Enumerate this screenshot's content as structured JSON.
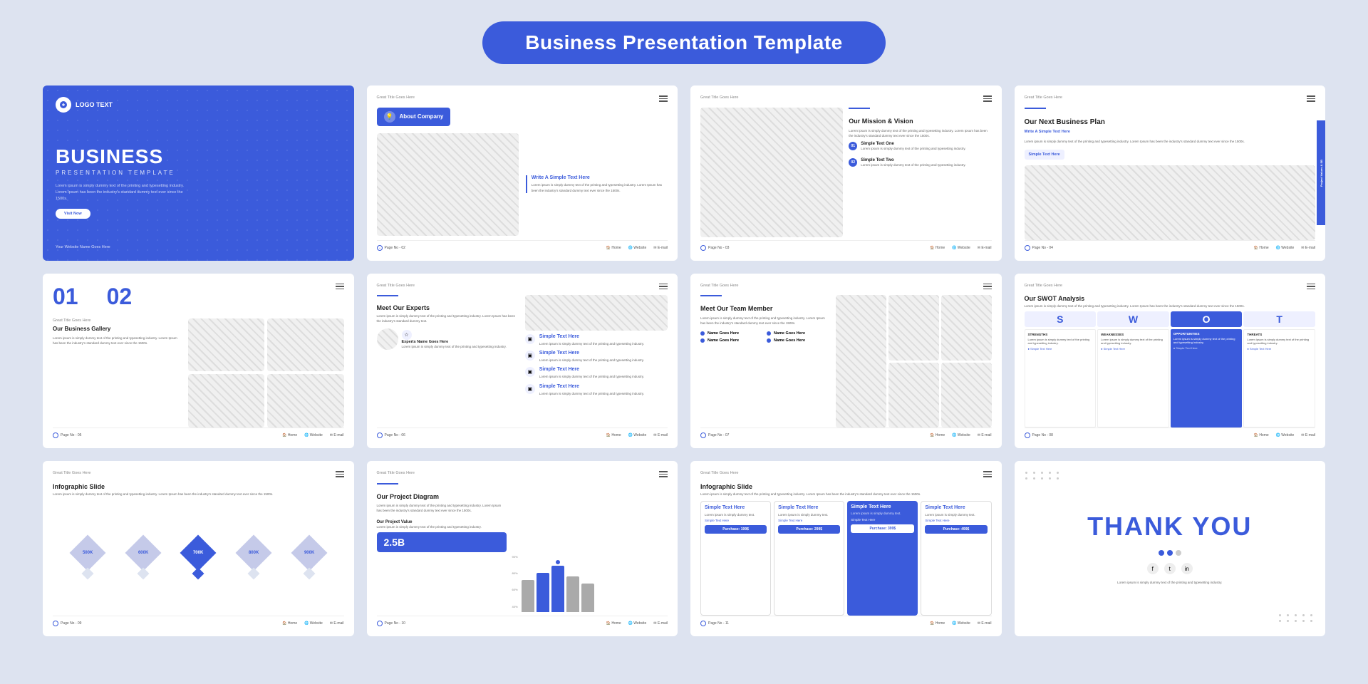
{
  "page": {
    "title": "Business Presentation Template",
    "background": "#dde3f0"
  },
  "slides": [
    {
      "id": 1,
      "type": "cover",
      "logo": "LOGO TEXT",
      "title": "BUSINESS",
      "subtitle": "PRESENTATION TEMPLATE",
      "description": "Lorem ipsum is simply dummy text of the printing and typesetting industry. Lorem Ipsum has been the industry's standard dummy text ever since the 1500s.",
      "button": "Visit Now",
      "website": "Your Website Name Goes Here"
    },
    {
      "id": 2,
      "type": "about",
      "great_title": "Great Title Goes Here",
      "badge": "About Company",
      "write_title": "Write A Simple Text Here",
      "description": "Lorem ipsum is simply dummy text of the printing and typesetting industry. Lorem Ipsum has been the industry's standard dummy text ever since the 1500s.",
      "page": "Page No - 02",
      "footer": [
        "Home",
        "Website",
        "E-mail"
      ]
    },
    {
      "id": 3,
      "type": "mission",
      "great_title": "Great Title Goes Here",
      "title": "Our Mission & Vision",
      "description": "Lorem ipsum is simply dummy text of the printing and typesetting industry. Lorem Ipsum has been the industry's standard dummy text ever since the 1500s.",
      "items": [
        {
          "num": "01",
          "title": "Simple Text One",
          "text": "Lorem ipsum is simply dummy text of the printing and typesetting industry."
        },
        {
          "num": "02",
          "title": "Simple Text Two",
          "text": "Lorem ipsum is simply dummy text of the printing and typesetting industry."
        }
      ],
      "page": "Page No - 03",
      "footer": [
        "Home",
        "Website",
        "E-mail"
      ]
    },
    {
      "id": 4,
      "type": "bizplan",
      "great_title": "Great Title Goes Here",
      "title": "Our Next Business Plan",
      "write_title": "Write A Simple Text Here",
      "description": "Lorem ipsum is simply dummy text of the printing and typesetting industry. Lorem Ipsum has been the industry's standard dummy text ever since the 1500s.",
      "simple_text": "Simple Text Here",
      "tab_label": "Project Values & SB",
      "page": "Page No - 04",
      "footer": [
        "Home",
        "Website",
        "E-mail"
      ]
    },
    {
      "id": 5,
      "type": "gallery",
      "great_title": "Great Title Goes Here",
      "title": "Our Business Gallery",
      "nums": [
        "01",
        "02"
      ],
      "description": "Lorem ipsum is simply dummy text of the printing and typesetting industry. Lorem Ipsum has been the industry's standard dummy text ever since the 1500s.",
      "page": "Page No - 05",
      "footer": [
        "Home",
        "Website",
        "E-mail"
      ]
    },
    {
      "id": 6,
      "type": "experts",
      "great_title": "Great Title Goes Here",
      "title": "Meet Our Experts",
      "description": "Lorem ipsum is simply dummy text of the printing and typesetting industry. Lorem Ipsum has been the industry's standard dummy text.",
      "items": [
        {
          "label": "Simple Text Here",
          "text": "Lorem ipsum is simply dummy text of the printing and typesetting industry."
        },
        {
          "label": "Simple Text Here",
          "text": "Lorem ipsum is simply dummy text of the printing and typesetting industry."
        },
        {
          "label": "Simple Text Here",
          "text": "Lorem ipsum is simply dummy text of the printing and typesetting industry."
        },
        {
          "label": "Simple Text Here",
          "text": "Lorem ipsum is simply dummy text of the printing and typesetting industry."
        }
      ],
      "expert_icon": "☆",
      "expert_name": "Experts Name Goes Here",
      "expert_desc": "Lorem ipsum is simply dummy text of the printing and typesetting industry.",
      "page": "Page No - 06",
      "footer": [
        "Home",
        "Website",
        "E-mail"
      ]
    },
    {
      "id": 7,
      "type": "team",
      "great_title": "Great Title Goes Here",
      "title": "Meet Our Team Member",
      "description": "Lorem ipsum is simply dummy text of the printing and typesetting industry. Lorem Ipsum has been the industry's standard dummy text ever since the 1500s.",
      "members": [
        {
          "name": "Name Goes Here",
          "name2": "Name Goes Here"
        },
        {
          "name": "Name Goes Here",
          "name2": "Name Goes Here"
        }
      ],
      "page": "Page No - 07",
      "footer": [
        "Home",
        "Website",
        "E-mail"
      ]
    },
    {
      "id": 8,
      "type": "swot",
      "great_title": "Great Title Goes Here",
      "title": "Our SWOT Analysis",
      "description": "Lorem ipsum is simply dummy text of the printing and typesetting industry. Lorem Ipsum has been the industry's standard dummy text ever since the 1500s.",
      "letters": [
        "S",
        "W",
        "O",
        "T"
      ],
      "sections": [
        {
          "label": "STRENGTHS",
          "text": "Lorem ipsum is simply dummy text of the printing and typesetting industry."
        },
        {
          "label": "WEAKNESSES",
          "text": "Lorem ipsum is simply dummy text of the printing and typesetting industry."
        },
        {
          "label": "OPPORTUNITIES",
          "text": "Lorem ipsum is simply dummy text of the printing and typesetting industry."
        },
        {
          "label": "THREATS",
          "text": "Lorem ipsum is simply dummy text of the printing and typesetting industry."
        }
      ],
      "page": "Page No - 08",
      "footer": [
        "Home",
        "Website",
        "E-mail"
      ]
    },
    {
      "id": 9,
      "type": "infographic1",
      "great_title": "Great Title Goes Here",
      "title": "Infographic Slide",
      "description": "Lorem ipsum is simply dummy text of the printing and typesetting industry. Lorem Ipsum has been the industry's standard dummy text ever since the 1500s.",
      "values": [
        "500K",
        "600K",
        "700K",
        "800K",
        "900K"
      ],
      "page": "Page No - 09",
      "footer": [
        "Home",
        "Website",
        "E-mail"
      ]
    },
    {
      "id": 10,
      "type": "project",
      "great_title": "Great Title Goes Here",
      "title": "Our Project Diagram",
      "description": "Lorem ipsum is simply dummy text of the printing and typesetting industry. Lorem Ipsum has been the industry's standard dummy text ever since the 1500s.",
      "project_value_label": "Our Project Value",
      "project_value_desc": "Lorem ipsum is simply dummy text of the printing and typesetting industry.",
      "value": "2.5B",
      "y_axis": [
        "90%",
        "80%",
        "60%",
        "40%"
      ],
      "page": "Page No - 10",
      "footer": [
        "Home",
        "Website",
        "E-mail"
      ]
    },
    {
      "id": 11,
      "type": "infographic2",
      "great_title": "Great Title Goes Here",
      "title": "Infographic Slide",
      "description": "Lorem ipsum is simply dummy text of the printing and typesetting industry. Lorem Ipsum has been the industry's standard dummy text ever since the 1500s.",
      "plans": [
        {
          "label": "Simple Text Here",
          "text": "Lorem ipsum is simply dummy text.",
          "sub": "Simple Text Here",
          "price": "Purchase: 199$"
        },
        {
          "label": "Simple Text Here",
          "text": "Lorem ipsum is simply dummy text.",
          "sub": "Simple Text Here",
          "price": "Purchase: 299$"
        },
        {
          "label": "Simple Text Here",
          "text": "Lorem ipsum is simply dummy text.",
          "sub": "Simple Text Here",
          "price": "Purchase: 399$",
          "highlight": true
        },
        {
          "label": "Simple Text Here",
          "text": "Lorem ipsum is simply dummy text.",
          "sub": "Simple Text Here",
          "price": "Purchase: 499$"
        }
      ],
      "page": "Page No - 11",
      "footer": [
        "Home",
        "Website",
        "E-mail"
      ]
    },
    {
      "id": 12,
      "type": "thankyou",
      "title": "THANK YOU",
      "description": "Lorem ipsum is simply dummy text of the printing and typesetting industry.",
      "dots": [
        false,
        false,
        false,
        true,
        true,
        false,
        false,
        false,
        false,
        false,
        false,
        false,
        false,
        false,
        false,
        false,
        false,
        false
      ]
    }
  ]
}
